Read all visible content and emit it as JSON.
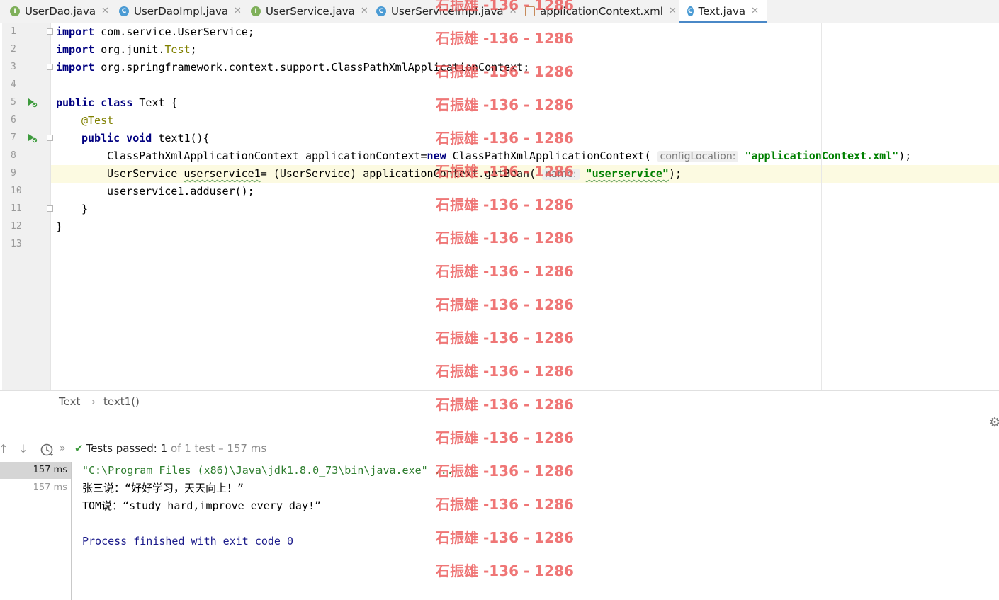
{
  "tabs": [
    {
      "label": "UserDao.java",
      "icon": "interface-icon",
      "icon_letter": "I",
      "active": false
    },
    {
      "label": "UserDaoImpl.java",
      "icon": "class-icon",
      "icon_letter": "C",
      "active": false
    },
    {
      "label": "UserService.java",
      "icon": "interface-icon",
      "icon_letter": "I",
      "active": false
    },
    {
      "label": "UserServiceImpl.java",
      "icon": "class-icon",
      "icon_letter": "C",
      "active": false
    },
    {
      "label": "applicationContext.xml",
      "icon": "xml-file-icon",
      "icon_letter": "",
      "active": false
    },
    {
      "label": "Text.java",
      "icon": "class-test-icon",
      "icon_letter": "C",
      "active": true
    }
  ],
  "close_glyph": "✕",
  "editor": {
    "line_numbers": [
      "1",
      "2",
      "3",
      "4",
      "5",
      "6",
      "7",
      "8",
      "9",
      "10",
      "11",
      "12",
      "13"
    ],
    "current_line": 9,
    "lines": {
      "l1": {
        "kw": "import",
        "rest": " com.service.UserService;"
      },
      "l2": {
        "kw": "import",
        "pkg": " org.junit.",
        "cls": "Test",
        "semi": ";"
      },
      "l3": {
        "kw": "import",
        "rest": " org.springframework.context.support.ClassPathXmlApplicationContext;"
      },
      "l5": {
        "kw1": "public",
        "kw2": "class",
        "rest": " Text {"
      },
      "l6": {
        "annotation": "@Test"
      },
      "l7": {
        "kw1": "public",
        "kw2": "void",
        "rest": " text1(){"
      },
      "l8": {
        "pre": "ClassPathXmlApplicationContext applicationContext=",
        "kw": "new",
        "mid": " ClassPathXmlApplicationContext(",
        "hint": "configLocation:",
        "str": "\"applicationContext.xml\"",
        "post": ");"
      },
      "l9": {
        "pre": "UserService ",
        "var": "userservice1",
        "mid": "= (UserService) applicationContext.getBean(",
        "hint": "name:",
        "str": "\"userservice\"",
        "post": ");"
      },
      "l10": {
        "text": "userservice1.adduser();"
      },
      "l11": {
        "text": "}"
      },
      "l12": {
        "text": "}"
      }
    }
  },
  "breadcrumb": {
    "class_name": "Text",
    "separator": "›",
    "method": "text1()"
  },
  "run": {
    "status_label": "Tests passed:",
    "passed_count": "1",
    "of_text": "of 1 test – 157 ms",
    "times": [
      "157 ms",
      "157 ms"
    ],
    "output": [
      "\"C:\\Program Files (x86)\\Java\\jdk1.8.0_73\\bin\\java.exe\" ...",
      "张三说：“好好学习，天天向上！”",
      "TOM说：“study hard,improve every day!”",
      "",
      "Process finished with exit code 0"
    ]
  },
  "watermark": "石振雄 -136 - 1286"
}
